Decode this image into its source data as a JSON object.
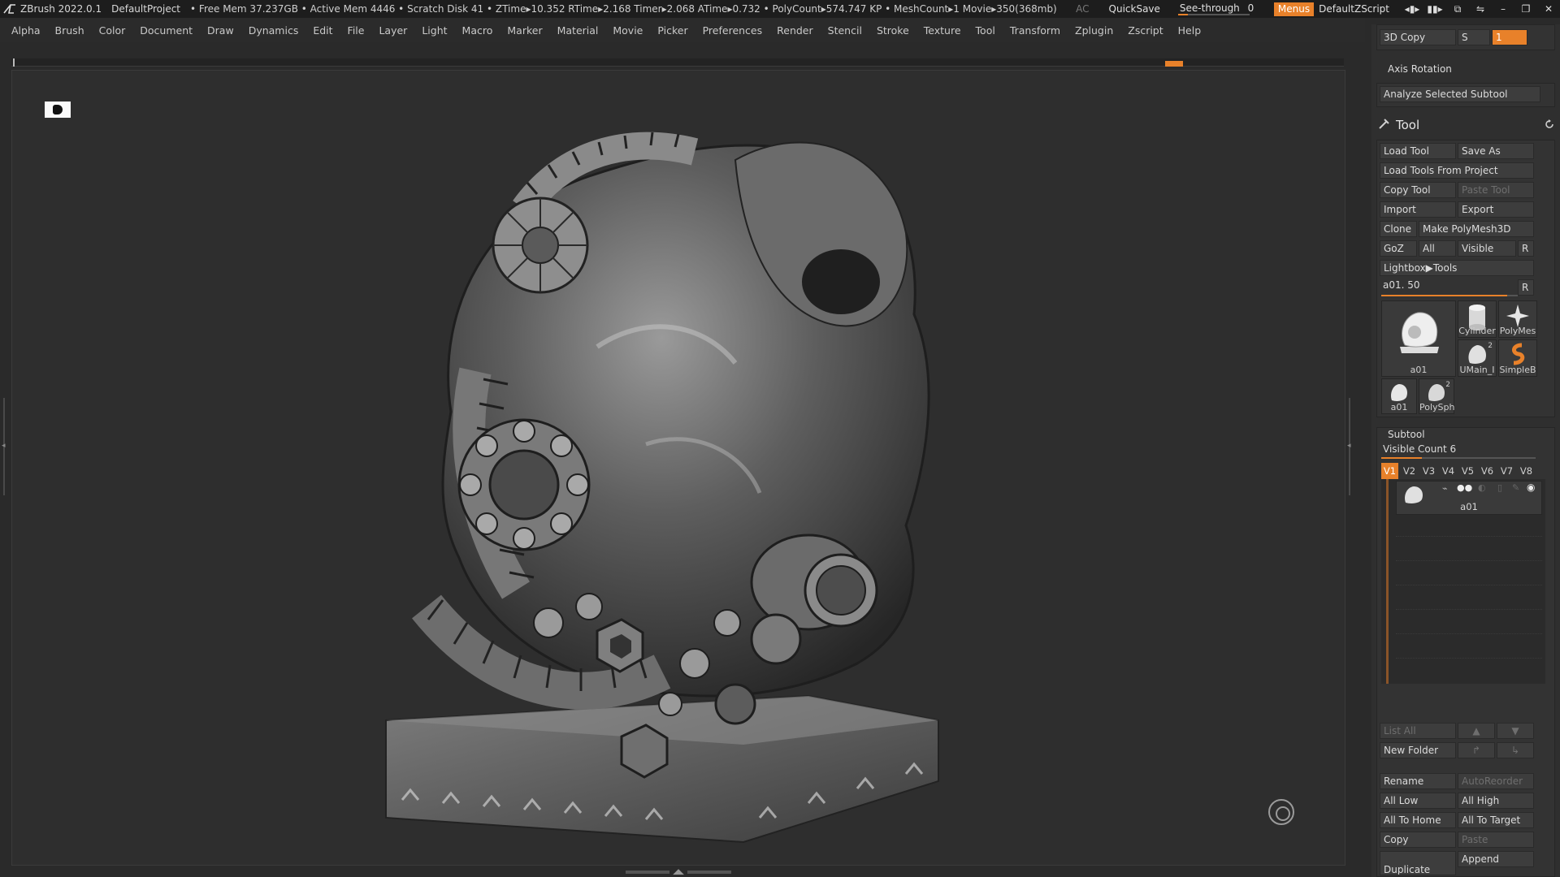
{
  "titlebar": {
    "app": "ZBrush 2022.0.1",
    "project": "DefaultProject",
    "status": "• Free Mem 37.237GB • Active Mem 4446 • Scratch Disk 41 •  ZTime▸10.352 RTime▸2.168 Timer▸2.068 ATime▸0.732 • PolyCount▸574.747 KP  • MeshCount▸1  Movie▸350(368mb)",
    "ac": "AC",
    "quicksave": "QuickSave",
    "see_through_label": "See-through",
    "see_through_value": "0",
    "see_through_level": 0.0,
    "menus": "Menus",
    "zscript": "DefaultZScript"
  },
  "menubar": [
    "Alpha",
    "Brush",
    "Color",
    "Document",
    "Draw",
    "Dynamics",
    "Edit",
    "File",
    "Layer",
    "Light",
    "Macro",
    "Marker",
    "Material",
    "Movie",
    "Picker",
    "Preferences",
    "Render",
    "Stencil",
    "Stroke",
    "Texture",
    "Tool",
    "Transform",
    "Zplugin",
    "Zscript",
    "Help"
  ],
  "panel": {
    "copy3d": "3D Copy",
    "s_label": "S",
    "s_value": "1",
    "axis_rotation": "Axis Rotation",
    "analyze": "Analyze Selected Subtool",
    "tool_title": "Tool",
    "load_tool": "Load Tool",
    "save_as": "Save As",
    "load_from_project": "Load Tools From Project",
    "copy_tool": "Copy Tool",
    "paste_tool": "Paste Tool",
    "import": "Import",
    "export": "Export",
    "clone": "Clone",
    "make_polymesh": "Make PolyMesh3D",
    "goz": "GoZ",
    "all": "All",
    "visible": "Visible",
    "r": "R",
    "lightbox": "Lightbox▶Tools",
    "current_tool": "a01. 50",
    "current_tool_level": 0.92,
    "thumbs": {
      "main": "a01",
      "cylinder": "Cylinder",
      "polymesh": "PolyMes",
      "umain": "UMain_I",
      "simpleb": "SimpleB",
      "a01_small": "a01",
      "polysph": "PolySph",
      "umain_count": "2",
      "polysph_count": "2"
    },
    "subtool_title": "Subtool",
    "visible_count": "Visible Count 6",
    "vtabs": [
      "V1",
      "V2",
      "V3",
      "V4",
      "V5",
      "V6",
      "V7",
      "V8"
    ],
    "subtool_item": "a01",
    "list_all": "List All",
    "new_folder": "New Folder",
    "rename": "Rename",
    "auto_reorder": "AutoReorder",
    "all_low": "All Low",
    "all_high": "All High",
    "all_to_home": "All To Home",
    "all_to_target": "All To Target",
    "copy": "Copy",
    "paste": "Paste",
    "duplicate": "Duplicate",
    "append": "Append"
  },
  "colors": {
    "accent": "#e8812a",
    "background": "#2a2a2a"
  }
}
